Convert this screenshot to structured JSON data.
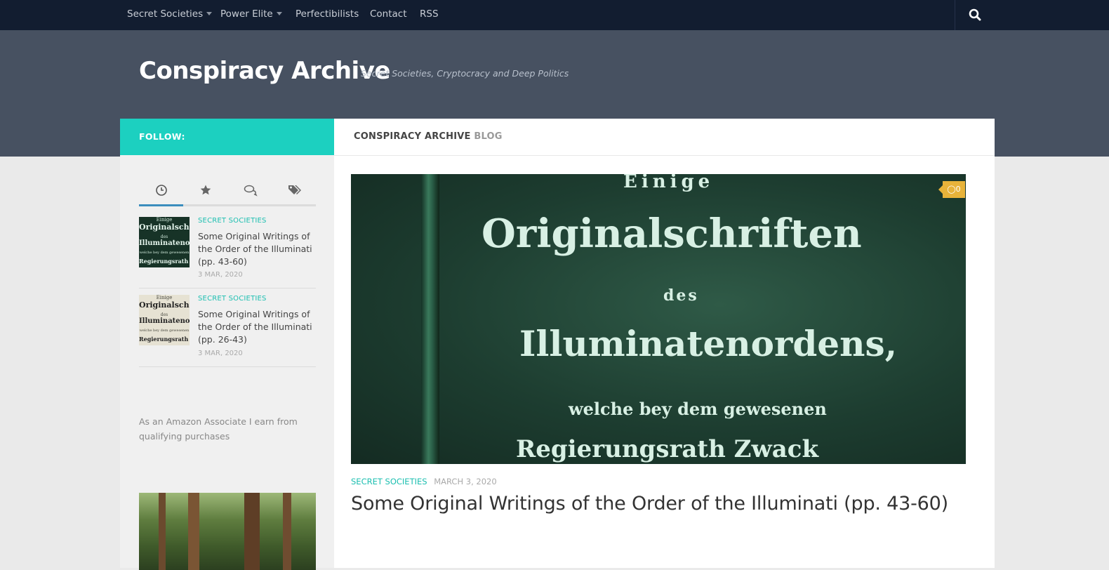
{
  "nav": {
    "items": [
      {
        "label": "Secret Societies",
        "dropdown": true
      },
      {
        "label": "Power Elite",
        "dropdown": true
      },
      {
        "label": "Perfectibilists",
        "dropdown": false
      },
      {
        "label": "Contact",
        "dropdown": false
      },
      {
        "label": "RSS",
        "dropdown": false
      }
    ],
    "search_icon": "search-icon"
  },
  "site": {
    "title": "Conspiracy Archive",
    "tagline": "Secret Societies, Cryptocracy and Deep Politics"
  },
  "sidebar": {
    "follow_label": "FOLLOW:",
    "tabs": [
      {
        "icon": "clock-icon",
        "active": true
      },
      {
        "icon": "star-icon",
        "active": false
      },
      {
        "icon": "comments-icon",
        "active": false
      },
      {
        "icon": "tags-icon",
        "active": false
      }
    ],
    "recent_posts": [
      {
        "category": "SECRET SOCIETIES",
        "title": "Some Original Writings of the Order of the Illuminati (pp. 43-60)",
        "date": "3 MAR, 2020",
        "thumb_style": "dark"
      },
      {
        "category": "SECRET SOCIETIES",
        "title": "Some Original Writings of the Order of the Illuminati (pp. 26-43)",
        "date": "3 MAR, 2020",
        "thumb_style": "light"
      }
    ],
    "amazon_note": "As an Amazon Associate I earn from qualifying purchases"
  },
  "main": {
    "heading_primary": "CONSPIRACY ARCHIVE",
    "heading_secondary": "BLOG",
    "featured": {
      "image_lines": [
        "Einige",
        "Originalschriften",
        "des",
        "Illuminatenordens,",
        "welche bey dem gewesenen",
        "Regierungsrath Zwack"
      ],
      "comment_count": "0",
      "category": "SECRET SOCIETIES",
      "date": "MARCH 3, 2020",
      "title": "Some Original Writings of the Order of the Illuminati (pp. 43-60)"
    }
  },
  "colors": {
    "nav_bg": "#121d30",
    "header_bg": "#475161",
    "accent_teal": "#1cd0c0",
    "tab_active": "#3b8dbd",
    "badge": "#e8b33a"
  }
}
